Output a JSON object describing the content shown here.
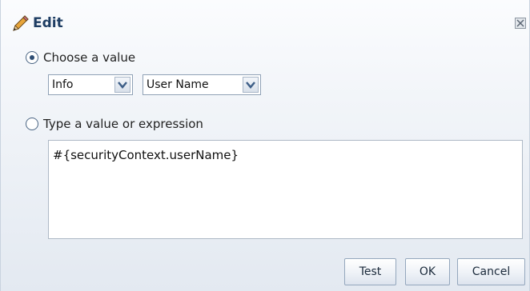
{
  "dialog": {
    "title": "Edit",
    "icons": {
      "title_icon": "pencil-icon",
      "close": "close-icon"
    }
  },
  "options": {
    "choose_value": {
      "label": "Choose a value",
      "checked": true
    },
    "type_value": {
      "label": "Type a value or expression",
      "checked": false
    }
  },
  "selects": {
    "scope": {
      "value": "Info"
    },
    "attribute": {
      "value": "User Name"
    }
  },
  "expression": {
    "value": "#{securityContext.userName}"
  },
  "buttons": {
    "test": "Test",
    "ok": "OK",
    "cancel": "Cancel"
  },
  "colors": {
    "title": "#1e3d63",
    "accent": "#2e4d73"
  }
}
